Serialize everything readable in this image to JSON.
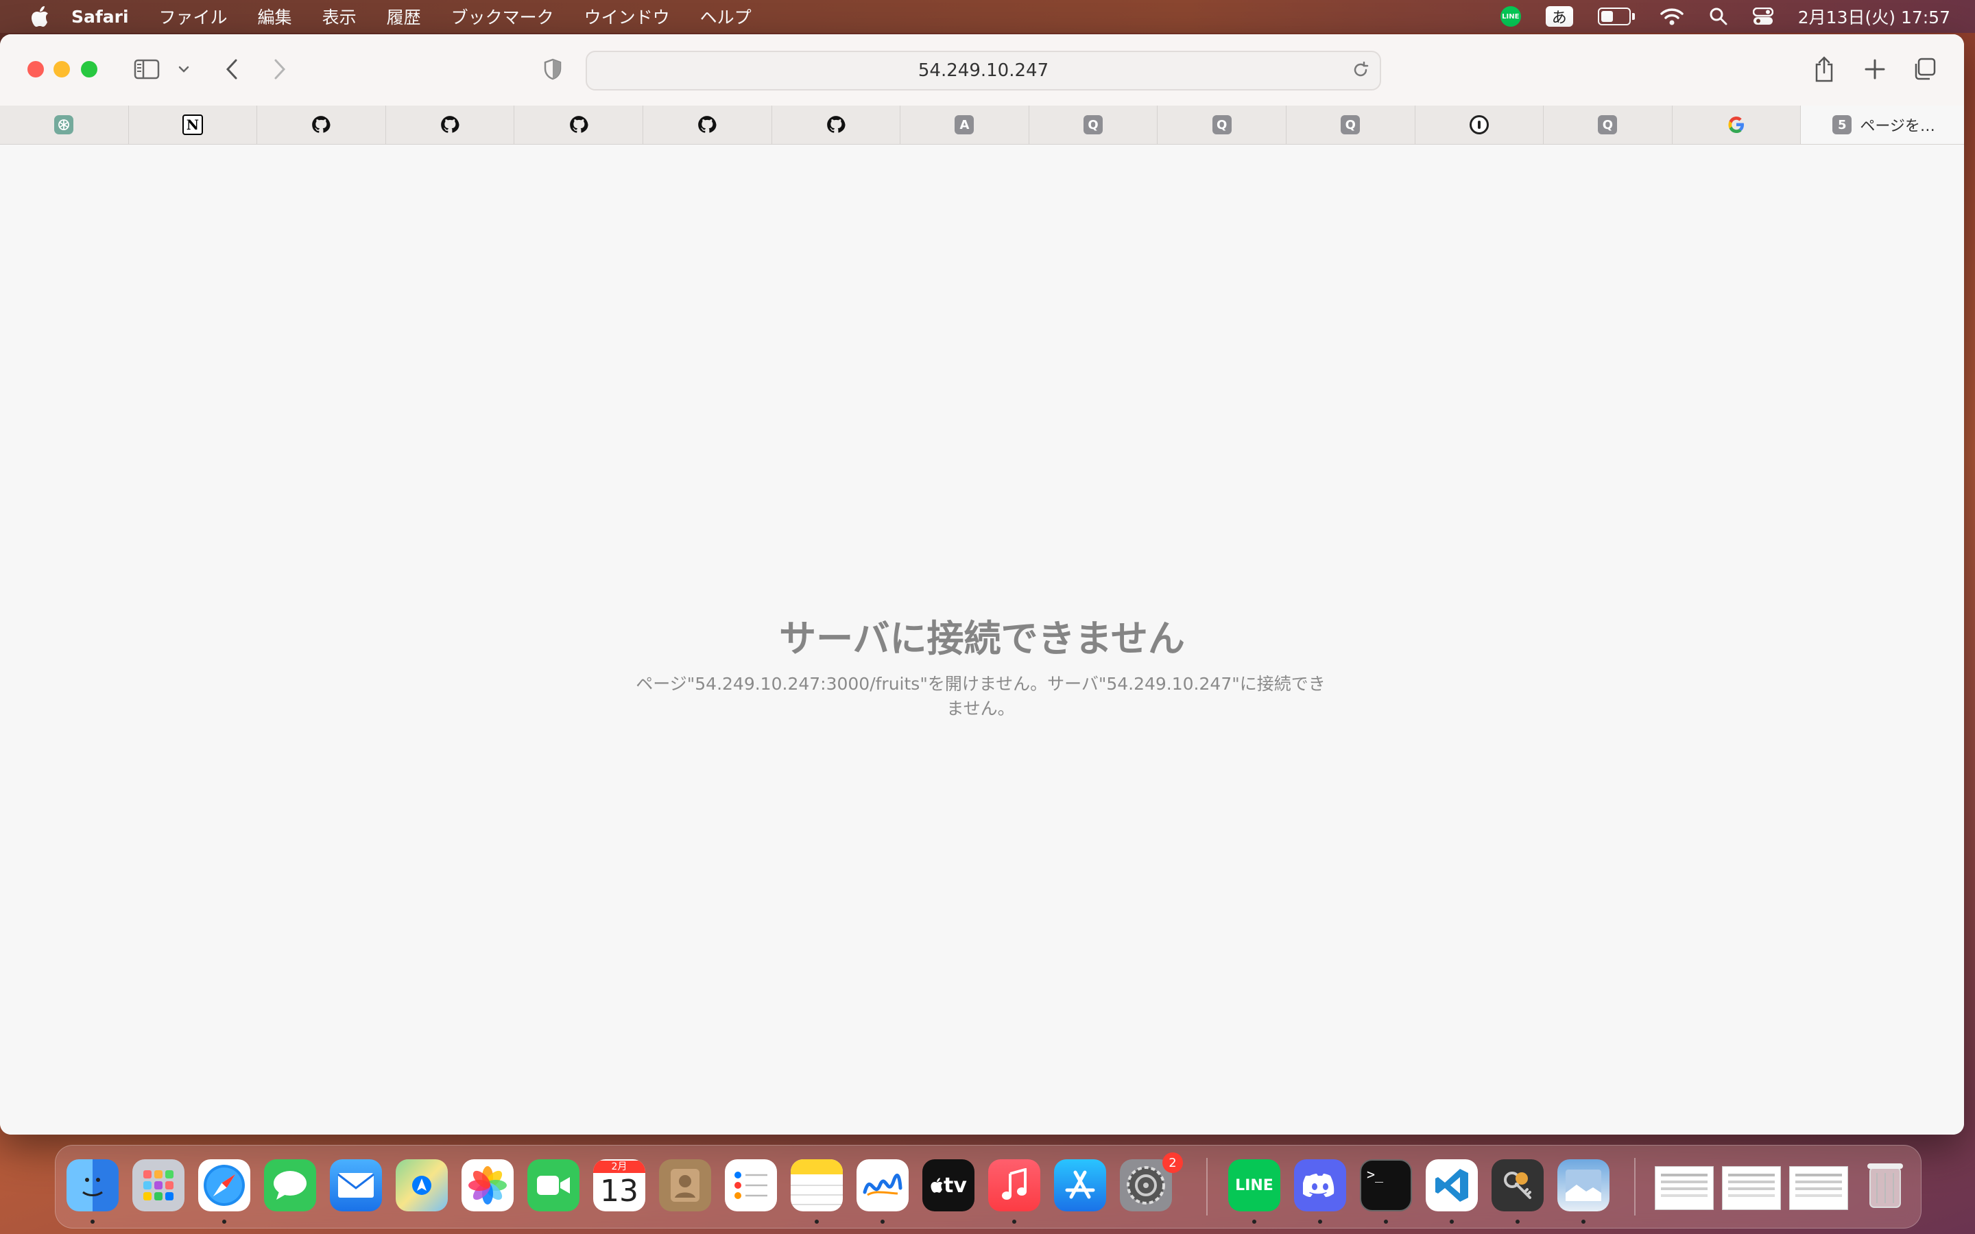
{
  "menubar": {
    "app_name": "Safari",
    "items": [
      "ファイル",
      "編集",
      "表示",
      "履歴",
      "ブックマーク",
      "ウインドウ",
      "ヘルプ"
    ],
    "status": {
      "line_label": "LINE",
      "ime_label": "あ",
      "battery_level": 0.45,
      "clock": "2月13日(火)  17:57"
    }
  },
  "browser": {
    "address_url": "54.249.10.247",
    "tabs": [
      {
        "icon": "chatgpt-icon",
        "glyph": ""
      },
      {
        "icon": "notion-icon",
        "glyph": "N"
      },
      {
        "icon": "github-icon",
        "glyph": ""
      },
      {
        "icon": "github-icon",
        "glyph": ""
      },
      {
        "icon": "github-icon",
        "glyph": ""
      },
      {
        "icon": "github-icon",
        "glyph": ""
      },
      {
        "icon": "github-icon",
        "glyph": ""
      },
      {
        "icon": "letter-a-icon",
        "glyph": "A"
      },
      {
        "icon": "letter-q-icon",
        "glyph": "Q"
      },
      {
        "icon": "letter-q-icon",
        "glyph": "Q"
      },
      {
        "icon": "letter-q-icon",
        "glyph": "Q"
      },
      {
        "icon": "1password-icon",
        "glyph": ""
      },
      {
        "icon": "letter-q-icon",
        "glyph": "Q"
      },
      {
        "icon": "google-icon",
        "glyph": ""
      }
    ],
    "active_tab": {
      "glyph": "5",
      "label": "ページを…"
    }
  },
  "error": {
    "title": "サーバに接続できません",
    "message": "ページ\"54.249.10.247:3000/fruits\"を開けません。サーバ\"54.249.10.247\"に接続できません。"
  },
  "dock": {
    "calendar_month": "2月",
    "calendar_day": "13",
    "tv_label": "tv",
    "settings_badge": "2",
    "line_label": "LINE",
    "terminal_prompt": ">_"
  },
  "colors": {
    "close": "#fe5f57",
    "minimize": "#febc2e",
    "maximize": "#28c840",
    "line_green": "#06c755"
  }
}
